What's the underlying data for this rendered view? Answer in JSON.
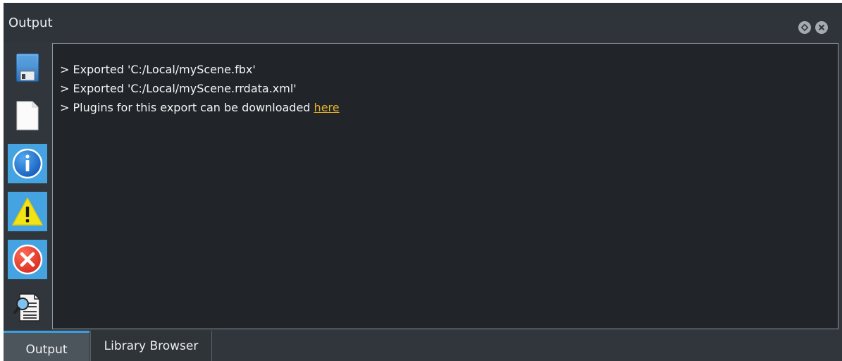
{
  "window": {
    "title": "Output"
  },
  "toolbar": {
    "items": [
      {
        "name": "save-log",
        "icon": "floppy-disk-icon"
      },
      {
        "name": "clear-log",
        "icon": "blank-page-icon"
      },
      {
        "name": "filter-info",
        "icon": "info-icon",
        "active": true
      },
      {
        "name": "filter-warning",
        "icon": "warning-icon",
        "active": true
      },
      {
        "name": "filter-error",
        "icon": "error-icon",
        "active": true
      },
      {
        "name": "search-log",
        "icon": "document-search-icon"
      }
    ]
  },
  "console": {
    "lines": [
      {
        "text": "> Exported 'C:/Local/myScene.fbx'"
      },
      {
        "text": "> Exported 'C:/Local/myScene.rrdata.xml'"
      },
      {
        "text": "> Plugins for this export can be downloaded ",
        "link": "here"
      }
    ]
  },
  "tabs": [
    {
      "label": "Output",
      "active": true
    },
    {
      "label": "Library Browser",
      "active": false
    }
  ],
  "colors": {
    "panel": "#30363b",
    "console_bg": "#212428",
    "active_filter": "#44a3e0",
    "link": "#e7b12b",
    "tab_accent": "#3e9fe0"
  }
}
